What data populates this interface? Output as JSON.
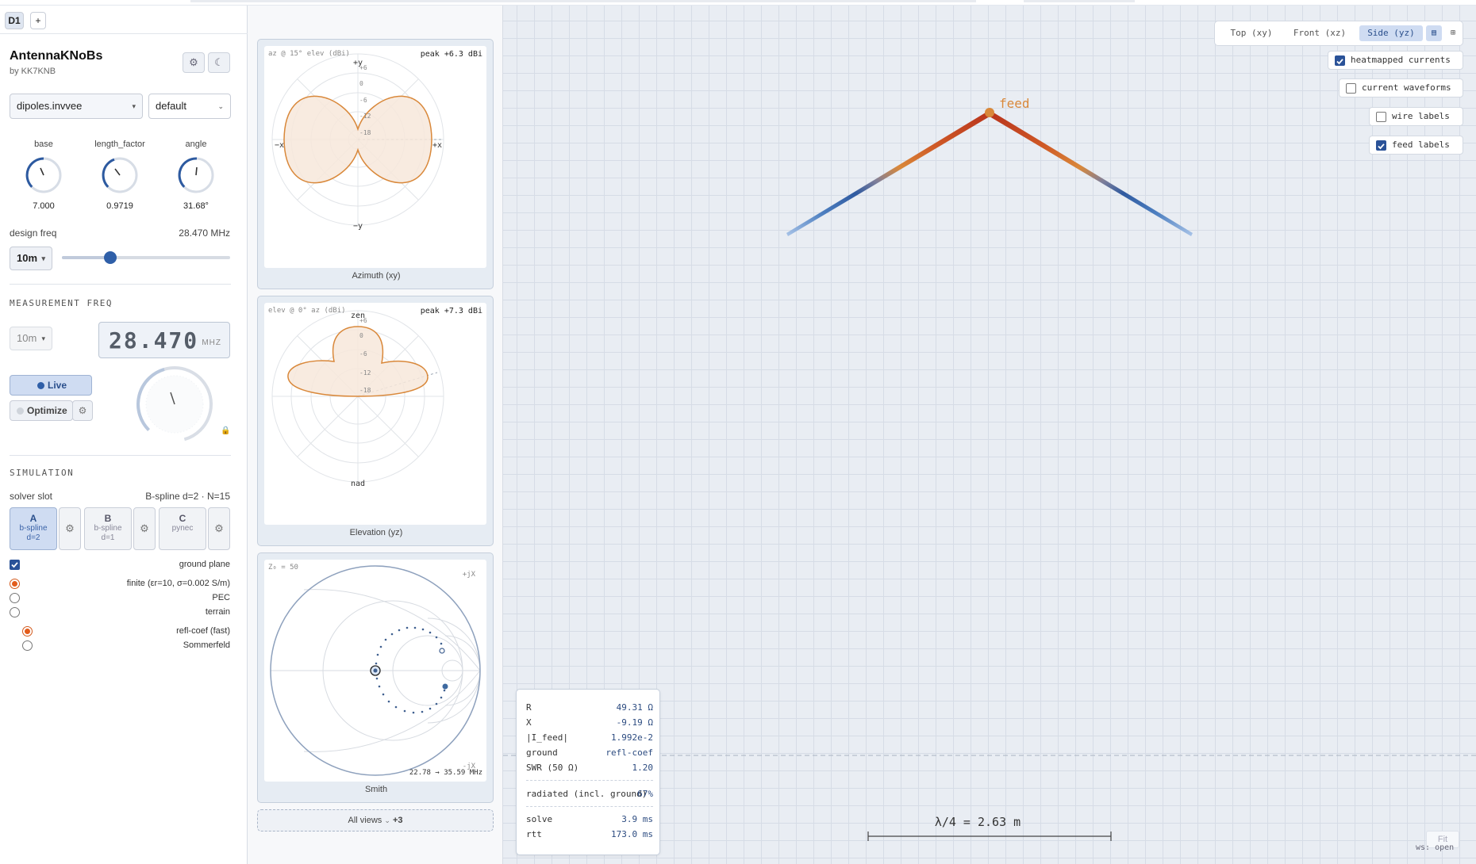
{
  "tabs": {
    "active": "D1",
    "add": "+"
  },
  "app": {
    "title": "AntennaKNoBs",
    "subtitle": "by KK7KNB",
    "settings_icon": "⚙",
    "theme_icon": "☾"
  },
  "design": {
    "preset": "dipoles.invvee",
    "variant": "default"
  },
  "knobs": [
    {
      "label": "base",
      "value": "7.000"
    },
    {
      "label": "length_factor",
      "value": "0.9719"
    },
    {
      "label": "angle",
      "value": "31.68°"
    }
  ],
  "design_freq": {
    "label": "design freq",
    "value": "28.470 MHz",
    "band": "10m",
    "slider_fraction": 0.29
  },
  "measurement": {
    "header": "MEASUREMENT FREQ",
    "band": "10m",
    "freq": "28.470",
    "unit": "MHZ"
  },
  "controls": {
    "live": "Live",
    "optimize": "Optimize"
  },
  "simulation": {
    "header": "SIMULATION",
    "solver_label": "solver slot",
    "solver_value": "B-spline d=2 · N=15",
    "slots": [
      {
        "letter": "A",
        "line1": "b-spline",
        "line2": "d=2",
        "active": true
      },
      {
        "letter": "B",
        "line1": "b-spline",
        "line2": "d=1",
        "active": false
      },
      {
        "letter": "C",
        "line1": "pynec",
        "line2": "",
        "active": false
      }
    ],
    "ground_plane": {
      "label": "ground plane",
      "checked": true
    },
    "ground_types": [
      {
        "label": "finite (εr=10, σ=0.002 S/m)",
        "selected": true
      },
      {
        "label": "PEC",
        "selected": false
      },
      {
        "label": "terrain",
        "selected": false
      }
    ],
    "ground_methods": [
      {
        "label": "refl-coef (fast)",
        "selected": true
      },
      {
        "label": "Sommerfeld",
        "selected": false
      }
    ]
  },
  "plots": {
    "azimuth": {
      "corner": "az @ 15° elev (dBi)",
      "peak": "peak +6.3 dBi",
      "caption": "Azimuth (xy)",
      "axis": {
        "top": "+y",
        "bottom": "−y",
        "left": "−x",
        "right": "+x"
      },
      "rings": [
        "+6",
        "0",
        "-6",
        "-12",
        "-18"
      ]
    },
    "elevation": {
      "corner": "elev @ 0° az (dBi)",
      "peak": "peak +7.3 dBi",
      "caption": "Elevation (yz)",
      "axis": {
        "top": "zen",
        "bottom": "nad"
      },
      "rings": [
        "+6",
        "0",
        "-6",
        "-12",
        "-18"
      ]
    },
    "smith": {
      "corner": "Z₀ = 50",
      "top_right": "+jX",
      "bottom_right": "-jX",
      "range": "22.78 → 35.59 MHz",
      "caption": "Smith"
    }
  },
  "all_views": {
    "label": "All views",
    "count": "+3"
  },
  "view": {
    "buttons": [
      "Top (xy)",
      "Front (xz)",
      "Side (yz)"
    ],
    "active": "Side (yz)",
    "layout_icons": [
      "single-view-icon",
      "grid-view-icon"
    ]
  },
  "toggles": [
    {
      "label": "heatmapped currents",
      "checked": true
    },
    {
      "label": "current waveforms",
      "checked": false
    },
    {
      "label": "wire labels",
      "checked": false
    },
    {
      "label": "feed labels",
      "checked": true
    }
  ],
  "feed_label": "feed",
  "readout": {
    "rows": [
      {
        "k": "R",
        "v": "49.31 Ω"
      },
      {
        "k": "X",
        "v": "-9.19 Ω"
      },
      {
        "k": "|I_feed|",
        "v": "1.992e-2"
      },
      {
        "k": "ground",
        "v": "refl-coef"
      },
      {
        "k": "SWR (50 Ω)",
        "v": "1.20"
      }
    ],
    "radiated": {
      "k": "radiated (incl. ground)",
      "v": "67%"
    },
    "timing": [
      {
        "k": "solve",
        "v": "3.9 ms"
      },
      {
        "k": "rtt",
        "v": "173.0 ms"
      }
    ]
  },
  "scale": {
    "label": "λ/4 = 2.63 m"
  },
  "fit": "Fit",
  "ws_status": "ws: open",
  "colors": {
    "accent": "#2f5fa8",
    "pattern": "#d9883a",
    "radio": "#e35c1c",
    "active_bg": "#cfdcf2"
  }
}
